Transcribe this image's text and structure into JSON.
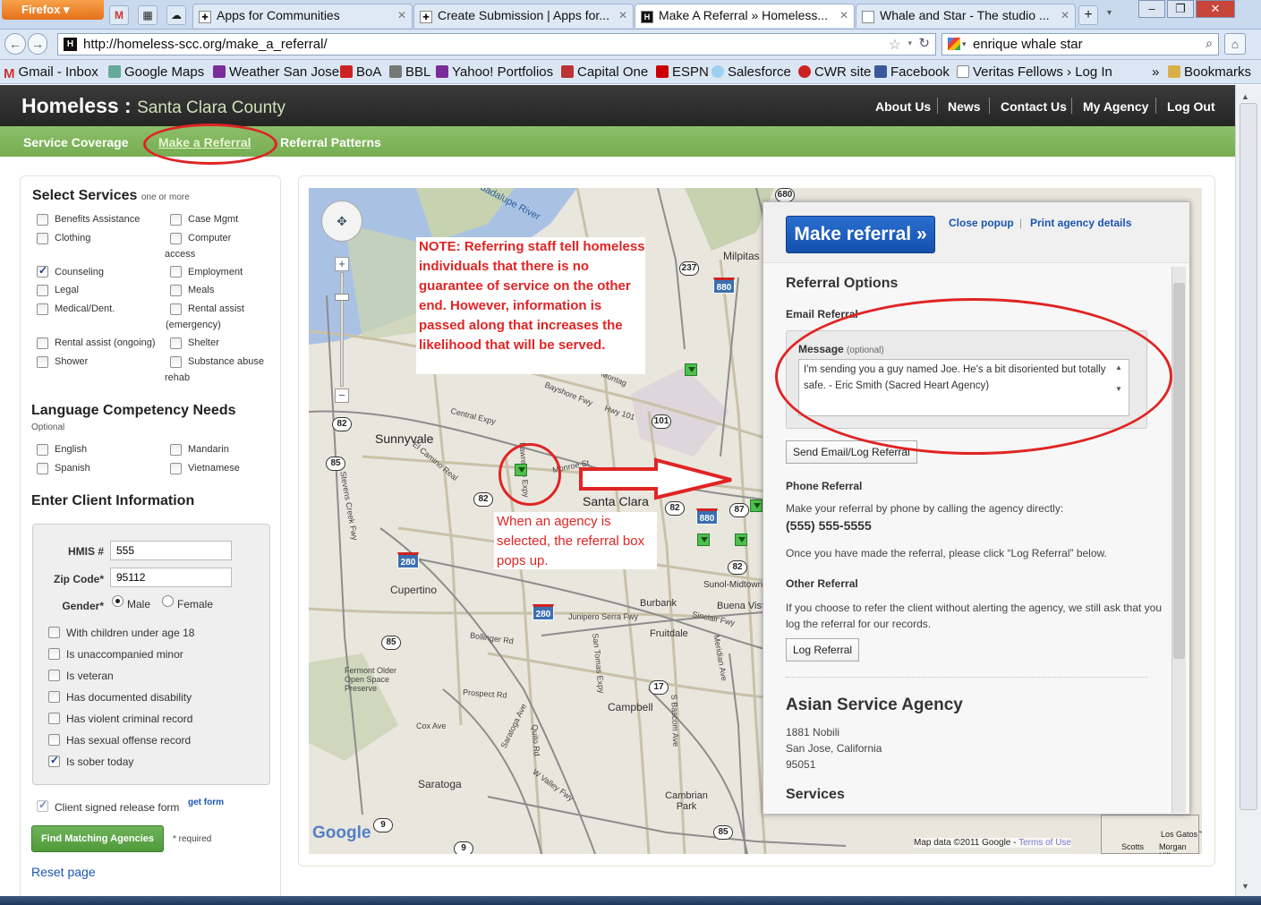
{
  "browser": {
    "menu_label": "Firefox",
    "tabs": [
      {
        "label": "Apps for Communities"
      },
      {
        "label": "Create Submission | Apps for..."
      },
      {
        "label": "Make A Referral » Homeless..."
      },
      {
        "label": "Whale and Star - The studio ..."
      }
    ],
    "new_tab": "+",
    "url": "http://homeless-scc.org/make_a_referral/",
    "search_value": "enrique whale star",
    "bookmarks": [
      "Gmail - Inbox",
      "Google Maps",
      "Weather San Jose",
      "BoA",
      "BBL",
      "Yahoo! Portfolios",
      "Capital One",
      "ESPN",
      "Salesforce",
      "CWR site",
      "Facebook",
      "Veritas Fellows › Log In"
    ],
    "bookmarks_menu": "Bookmarks",
    "overflow": "»"
  },
  "site": {
    "brand": "Homeless",
    "brand_sep": " : ",
    "brand_sub": "Santa Clara County",
    "top_nav": [
      "About Us",
      "News",
      "Contact Us",
      "My Agency",
      "Log Out"
    ],
    "sub_nav": [
      "Service Coverage",
      "Make a Referral",
      "Referral Patterns"
    ]
  },
  "services": {
    "heading": "Select Services",
    "heading_note": "one or more",
    "items": [
      {
        "label": "Benefits Assistance",
        "checked": false
      },
      {
        "label": "Case Mgmt",
        "checked": false
      },
      {
        "label": "Clothing",
        "checked": false
      },
      {
        "label": "Computer",
        "checked": false
      },
      {
        "label": "access",
        "checked": false
      },
      {
        "label": "Counseling",
        "checked": true
      },
      {
        "label": "Employment",
        "checked": false
      },
      {
        "label": "Legal",
        "checked": false
      },
      {
        "label": "Meals",
        "checked": false
      },
      {
        "label": "Medical/Dent.",
        "checked": false
      },
      {
        "label": "Rental assist",
        "checked": false
      },
      {
        "label": "(emergency)",
        "checked": false
      },
      {
        "label": "Rental assist (ongoing)",
        "checked": false
      },
      {
        "label": "Shelter",
        "checked": false
      },
      {
        "label": "Shower",
        "checked": false
      },
      {
        "label": "Substance abuse",
        "checked": false
      },
      {
        "label": "rehab",
        "checked": false
      }
    ]
  },
  "language": {
    "heading": "Language Competency Needs",
    "note": "Optional",
    "items": [
      "English",
      "Mandarin",
      "Spanish",
      "Vietnamese"
    ]
  },
  "client": {
    "heading": "Enter Client Information",
    "hmis_label": "HMIS #",
    "hmis_value": "555",
    "zip_label": "Zip Code*",
    "zip_value": "95112",
    "gender_label": "Gender*",
    "gender_male": "Male",
    "gender_female": "Female",
    "flags": [
      {
        "label": "With children under age 18",
        "checked": false
      },
      {
        "label": "Is unaccompanied minor",
        "checked": false
      },
      {
        "label": "Is veteran",
        "checked": false
      },
      {
        "label": "Has documented disability",
        "checked": false
      },
      {
        "label": "Has violent criminal record",
        "checked": false
      },
      {
        "label": "Has sexual offense record",
        "checked": false
      },
      {
        "label": "Is sober today",
        "checked": true
      }
    ],
    "release_label": "Client signed release form",
    "get_form": "get form",
    "find_button": "Find Matching Agencies",
    "required_note": "* required",
    "reset": "Reset page"
  },
  "popup": {
    "make_referral": "Make referral »",
    "close_popup": "Close popup",
    "sep": "|",
    "print": "Print agency details",
    "options_heading": "Referral Options",
    "email_heading": "Email Referral",
    "message_label": "Message",
    "message_optional": "(optional)",
    "message_text": "I'm sending you a guy named Joe.  He's a bit disoriented but totally safe.   - Eric Smith (Sacred Heart Agency)",
    "send_button": "Send Email/Log Referral",
    "phone_heading": "Phone Referral",
    "phone_text": "Make your referral by phone by calling the agency directly:",
    "phone_number": "(555) 555-5555",
    "phone_note": "Once you have made the referral, please click “Log Referral” below.",
    "other_heading": "Other Referral",
    "other_text": "If you choose to refer the client without alerting the agency, we still ask that you log the referral for our records.",
    "log_button": "Log Referral",
    "agency_name": "Asian Service Agency",
    "agency_address1": "1881 Nobili",
    "agency_address2": "San Jose, California",
    "agency_zip": "95051",
    "services_heading": "Services"
  },
  "map": {
    "places": [
      "Sunnyvale",
      "Santa Clara",
      "Cupertino",
      "Campbell",
      "Saratoga",
      "Milpitas",
      "Burbank",
      "Fruitdale",
      "Buena Vist",
      "Sunol-Midtown",
      "Cambrian Park",
      "Fermont Older Open Space Preserve",
      "Guadalupe River"
    ],
    "roads": [
      "Bayshore Fwy",
      "Central Expy",
      "El Camino Real",
      "Lawrence Expy",
      "Monroe St",
      "Stevens Creek Fwy",
      "Junipero Serra Fwy",
      "Bollinger Rd",
      "Prospect Rd",
      "Saratoga Ave",
      "Quito Rd",
      "W Valley Fwy",
      "San Tomas Expy",
      "Sinclair Fwy",
      "Meridian Ave",
      "S Bascom Ave",
      "Cox Ave",
      "Hwy 101",
      "Montag"
    ],
    "shields": [
      "680",
      "237",
      "880",
      "101",
      "82",
      "85",
      "280",
      "87",
      "17",
      "9"
    ],
    "attribution": "Map data ©2011 Google -",
    "terms": "Terms of Use",
    "inset_labels": [
      "Scotts",
      "Morgan Hill",
      "Los Gatos"
    ]
  },
  "annotations": {
    "note": "NOTE: Referring staff tell homeless individuals that there is no guarantee of service on the other end.  However, information is passed along that increases the likelihood that will be served.",
    "popup_note": "When an agency is selected, the referral box pops up."
  }
}
